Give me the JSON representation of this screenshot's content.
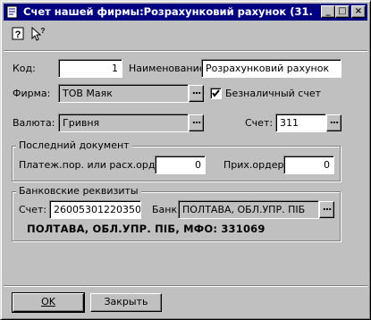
{
  "window": {
    "title": "Счет нашей фирмы:Розрахунковий рахунок (31.12.20...",
    "minimize": "_",
    "maximize": "□",
    "close": "×"
  },
  "toolbar": {
    "help_icon": "?",
    "whatsthis_icon": "?"
  },
  "form": {
    "kod_label": "Код:",
    "kod_value": "1",
    "name_label": "Наименование:",
    "name_value": "Розрахунковий рахунок",
    "firm_label": "Фирма:",
    "firm_value": "ТОВ Маяк",
    "cashless_label": "Безналичный счет",
    "cashless_checked": true,
    "currency_label": "Валюта:",
    "currency_value": "Гривня",
    "account_label": "Счет:",
    "account_value": "311",
    "ellipsis": "..."
  },
  "last_doc": {
    "title": "Последний документ",
    "payment_label": "Платеж.пор. или расх.ордер:",
    "payment_value": "0",
    "receipt_label": "Прих.ордер:",
    "receipt_value": "0"
  },
  "bank": {
    "title": "Банковские реквизиты",
    "account_label": "Счет:",
    "account_value": "26005301220350",
    "bank_label": "Банк:",
    "bank_value": "ПОЛТАВА, ОБЛ.УПР. ПІБ",
    "details": "ПОЛТАВА, ОБЛ.УПР. ПІБ, МФО: 331069"
  },
  "buttons": {
    "ok_label": "OK",
    "close_label": "Закрыть"
  }
}
